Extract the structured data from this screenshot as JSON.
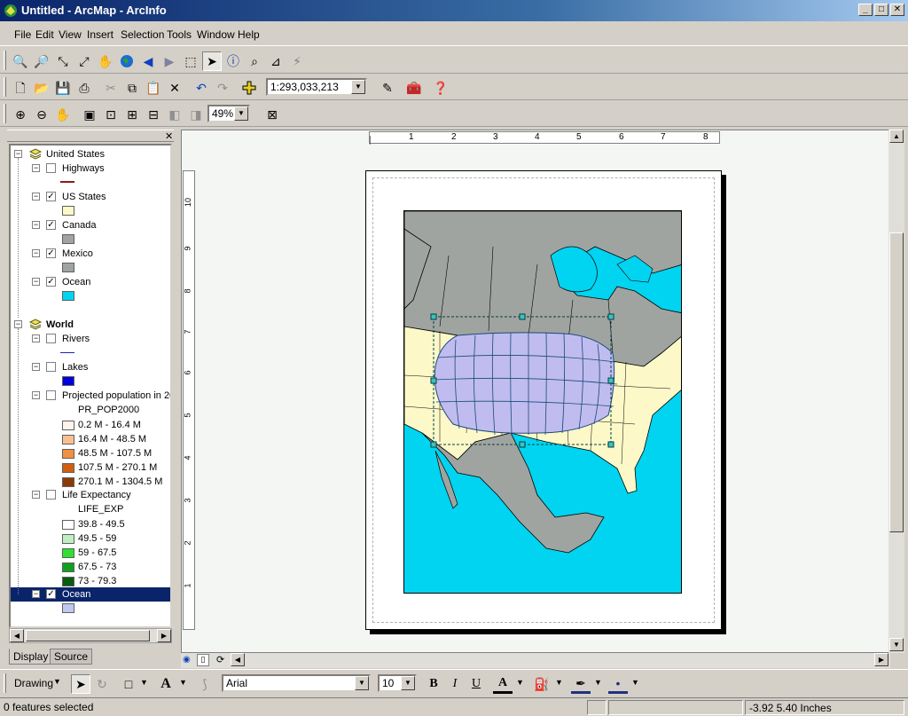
{
  "window": {
    "title": "Untitled - ArcMap - ArcInfo"
  },
  "menu": [
    "File",
    "Edit",
    "View",
    "Insert",
    "Selection",
    "Tools",
    "Window",
    "Help"
  ],
  "toolbar": {
    "scale": "1:293,033,213",
    "zoom": "49%"
  },
  "toc": {
    "groups": [
      {
        "name": "United States",
        "layers": [
          {
            "name": "Highways",
            "checked": false
          },
          {
            "name": "US States",
            "checked": true
          },
          {
            "name": "Canada",
            "checked": true
          },
          {
            "name": "Mexico",
            "checked": true
          },
          {
            "name": "Ocean",
            "checked": true
          }
        ]
      },
      {
        "name": "World",
        "layers": [
          {
            "name": "Rivers",
            "checked": false
          },
          {
            "name": "Lakes",
            "checked": false
          },
          {
            "name": "Projected population in 20",
            "checked": false,
            "field": "PR_POP2000",
            "classes": [
              "0.2 M - 16.4 M",
              "16.4 M - 48.5 M",
              "48.5 M - 107.5 M",
              "107.5 M - 270.1 M",
              "270.1 M - 1304.5 M"
            ]
          },
          {
            "name": "Life Expectancy",
            "checked": false,
            "field": "LIFE_EXP",
            "classes": [
              "39.8 - 49.5",
              "49.5 - 59",
              "59 - 67.5",
              "67.5 - 73",
              "73 - 79.3"
            ]
          },
          {
            "name": "Ocean",
            "checked": true,
            "selected": true
          }
        ]
      }
    ],
    "tabs": [
      "Display",
      "Source"
    ]
  },
  "ruler": {
    "h_ticks": [
      "1",
      "2",
      "3",
      "4",
      "5",
      "6",
      "7",
      "8"
    ],
    "v_ticks": [
      "10",
      "9",
      "8",
      "7",
      "6",
      "5",
      "4",
      "3",
      "2",
      "1"
    ]
  },
  "drawing": {
    "label": "Drawing",
    "font": "Arial",
    "size": "10",
    "bold": "B",
    "italic": "I",
    "underline": "U"
  },
  "status": {
    "selection": "0 features selected",
    "coords": "-3.92  5.40 Inches"
  },
  "colors": {
    "ocean": "#00d4f0",
    "land_gray": "#a0a4a0",
    "us_states": "#fcf8c8",
    "selected_graticule": "#c0bcf0",
    "highway": "#8b1a1a",
    "lakes": "#0000dd",
    "ocean_selected": "#c0c8f0"
  }
}
